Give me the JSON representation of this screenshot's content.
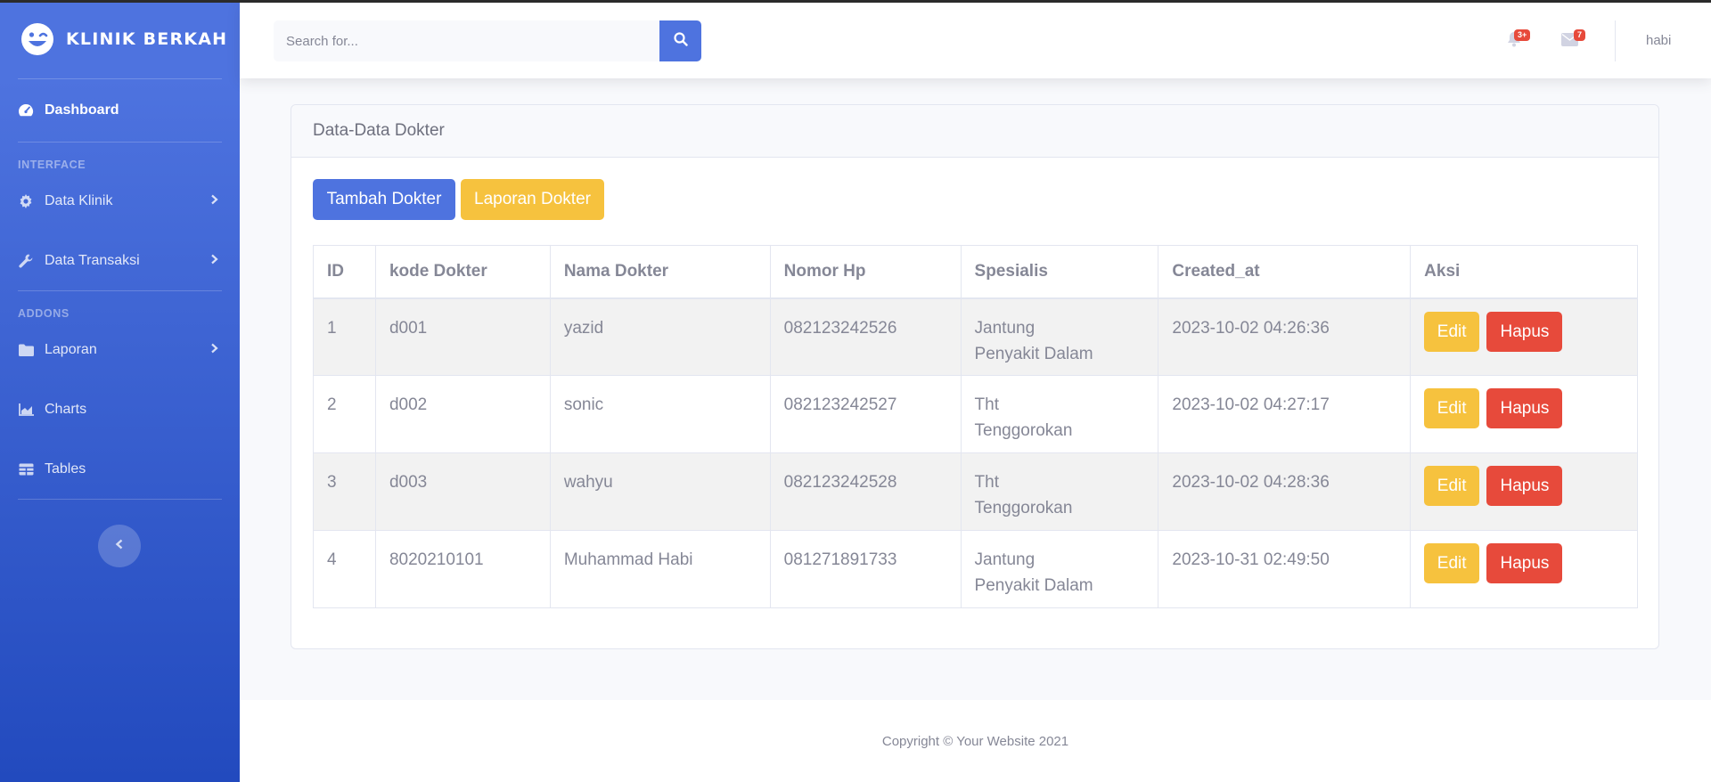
{
  "brand": {
    "name": "KLINIK BERKAH",
    "icon": "laugh-wink-icon"
  },
  "sidebar": {
    "dashboard": {
      "label": "Dashboard",
      "icon": "tachometer-icon"
    },
    "heading_interface": "INTERFACE",
    "data_klinik": {
      "label": "Data Klinik",
      "icon": "cog-icon"
    },
    "data_transaksi": {
      "label": "Data Transaksi",
      "icon": "wrench-icon"
    },
    "heading_addons": "ADDONS",
    "laporan": {
      "label": "Laporan",
      "icon": "folder-icon"
    },
    "charts": {
      "label": "Charts",
      "icon": "chart-area-icon"
    },
    "tables": {
      "label": "Tables",
      "icon": "table-icon"
    }
  },
  "topbar": {
    "search_placeholder": "Search for...",
    "alerts_badge": "3+",
    "messages_badge": "7",
    "username": "habi"
  },
  "card": {
    "title": "Data-Data Dokter",
    "add_button": "Tambah Dokter",
    "report_button": "Laporan Dokter"
  },
  "table": {
    "headers": [
      "ID",
      "kode Dokter",
      "Nama Dokter",
      "Nomor Hp",
      "Spesialis",
      "Created_at",
      "Aksi"
    ],
    "rows": [
      {
        "id": "1",
        "kode": "d001",
        "nama": "yazid",
        "hp": "082123242526",
        "spesialis_1": "Jantung",
        "spesialis_2": "Penyakit Dalam",
        "created_at": "2023-10-02 04:26:36"
      },
      {
        "id": "2",
        "kode": "d002",
        "nama": "sonic",
        "hp": "082123242527",
        "spesialis_1": "Tht",
        "spesialis_2": "Tenggorokan",
        "created_at": "2023-10-02 04:27:17"
      },
      {
        "id": "3",
        "kode": "d003",
        "nama": "wahyu",
        "hp": "082123242528",
        "spesialis_1": "Tht",
        "spesialis_2": "Tenggorokan",
        "created_at": "2023-10-02 04:28:36"
      },
      {
        "id": "4",
        "kode": "8020210101",
        "nama": "Muhammad Habi",
        "hp": "081271891733",
        "spesialis_1": "Jantung",
        "spesialis_2": "Penyakit Dalam",
        "created_at": "2023-10-31 02:49:50"
      }
    ],
    "edit_label": "Edit",
    "delete_label": "Hapus"
  },
  "footer": {
    "copyright": "Copyright © Your Website 2021"
  },
  "colors": {
    "primary": "#4e73df",
    "warning": "#f6c23e",
    "danger": "#e74a3b",
    "text": "#858796"
  }
}
